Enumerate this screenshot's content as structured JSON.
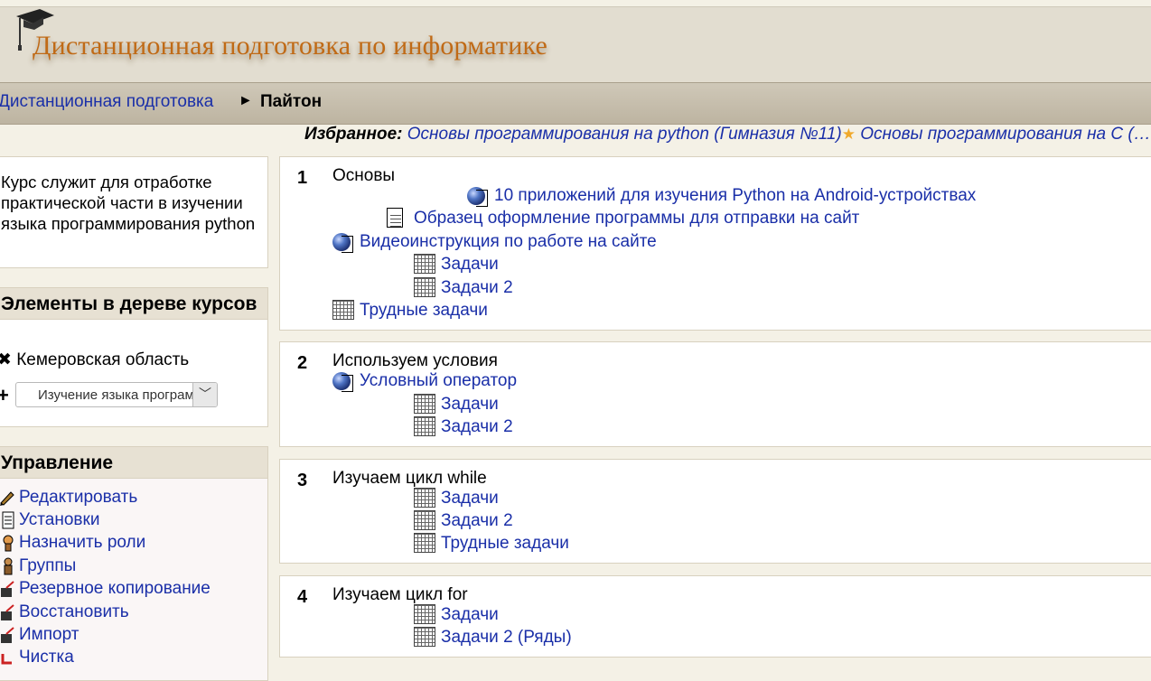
{
  "site": {
    "title": "Дистанционная подготовка по информатике"
  },
  "breadcrumb": {
    "root": "Дистанционная подготовка",
    "separator": "►",
    "current": "Пайтон"
  },
  "favorites": {
    "label": "Избранное:",
    "items": [
      "Основы программирования на python (Гимназия №11)",
      "Основы программирования на C (…"
    ]
  },
  "description": "Курс служит для отработке практической части в изучении языка программирования python",
  "tree": {
    "heading": "Элементы в дереве курсов",
    "region": "Кемеровская область",
    "collapse_icon": "close-icon",
    "expand_icon": "plus-icon",
    "select_value": "Изучение языка программирования"
  },
  "management": {
    "heading": "Управление",
    "items": [
      "Редактировать",
      "Установки",
      "Назначить роли",
      "Группы",
      "Резервное копирование",
      "Восстановить",
      "Импорт",
      "Чистка"
    ]
  },
  "sections": [
    {
      "num": "1",
      "title": "Основы",
      "items": [
        {
          "icon": "globe-icon",
          "label": "10 приложений для изучения Python на Android-устройствах"
        },
        {
          "icon": "document-icon",
          "label": "Образец оформление программы для отправки на сайт"
        },
        {
          "icon": "globe-icon",
          "label": "Видеоинструкция по работе на сайте"
        },
        {
          "icon": "quiz-icon",
          "label": "Задачи"
        },
        {
          "icon": "quiz-icon",
          "label": "Задачи 2"
        },
        {
          "icon": "quiz-icon",
          "label": "Трудные задачи"
        }
      ]
    },
    {
      "num": "2",
      "title": "Используем условия",
      "items": [
        {
          "icon": "globe-icon",
          "label": "Условный оператор"
        },
        {
          "icon": "quiz-icon",
          "label": "Задачи"
        },
        {
          "icon": "quiz-icon",
          "label": "Задачи 2"
        }
      ]
    },
    {
      "num": "3",
      "title": "Изучаем цикл while",
      "items": [
        {
          "icon": "quiz-icon",
          "label": "Задачи"
        },
        {
          "icon": "quiz-icon",
          "label": "Задачи 2"
        },
        {
          "icon": "quiz-icon",
          "label": "Трудные задачи"
        }
      ]
    },
    {
      "num": "4",
      "title": "Изучаем цикл for",
      "items": [
        {
          "icon": "quiz-icon",
          "label": "Задачи"
        },
        {
          "icon": "quiz-icon",
          "label": "Задачи 2 (Ряды)"
        }
      ]
    }
  ]
}
